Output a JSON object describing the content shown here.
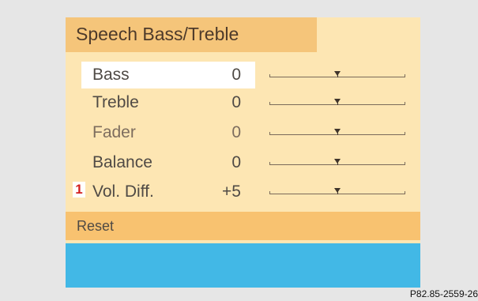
{
  "title": "Speech Bass/Treble",
  "rows": [
    {
      "label": "Bass",
      "value": "0",
      "level": 0.5
    },
    {
      "label": "Treble",
      "value": "0",
      "level": 0.5
    },
    {
      "label": "Fader",
      "value": "0",
      "level": 0.5
    },
    {
      "label": "Balance",
      "value": "0",
      "level": 0.5
    },
    {
      "label": "Vol. Diff.",
      "value": "+5",
      "level": 0.5
    }
  ],
  "callout_marker": "1",
  "reset_label": "Reset",
  "caption": "P82.85-2559-26",
  "colors": {
    "background": "#e6e6e6",
    "panel": "#fde6b3",
    "title_bar": "#f5c57a",
    "reset_bar": "#f8c270",
    "status_bar": "#42b8e6",
    "selection": "#ffffff",
    "callout": "#d21f1f"
  }
}
